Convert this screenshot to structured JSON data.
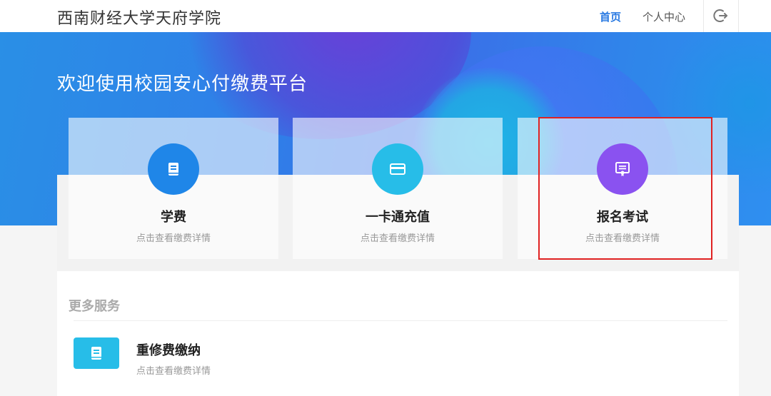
{
  "header": {
    "brand": "西南财经大学天府学院",
    "nav_home": "首页",
    "nav_personal": "个人中心",
    "logout_icon": "logout-icon"
  },
  "hero": {
    "title": "欢迎使用校园安心付缴费平台"
  },
  "cards": [
    {
      "title": "学费",
      "subtitle": "点击查看缴费详情",
      "icon": "book-icon",
      "color": "#1f86e8"
    },
    {
      "title": "一卡通充值",
      "subtitle": "点击查看缴费详情",
      "icon": "card-icon",
      "color": "#27bde8"
    },
    {
      "title": "报名考试",
      "subtitle": "点击查看缴费详情",
      "icon": "certificate-icon",
      "color": "#8a52f0"
    }
  ],
  "more": {
    "title": "更多服务",
    "items": [
      {
        "title": "重修费缴纳",
        "subtitle": "点击查看缴费详情",
        "icon": "book-icon",
        "color": "#27bde8"
      }
    ]
  },
  "colors": {
    "accent": "#2a7ae2",
    "highlight_border": "#e02222"
  }
}
